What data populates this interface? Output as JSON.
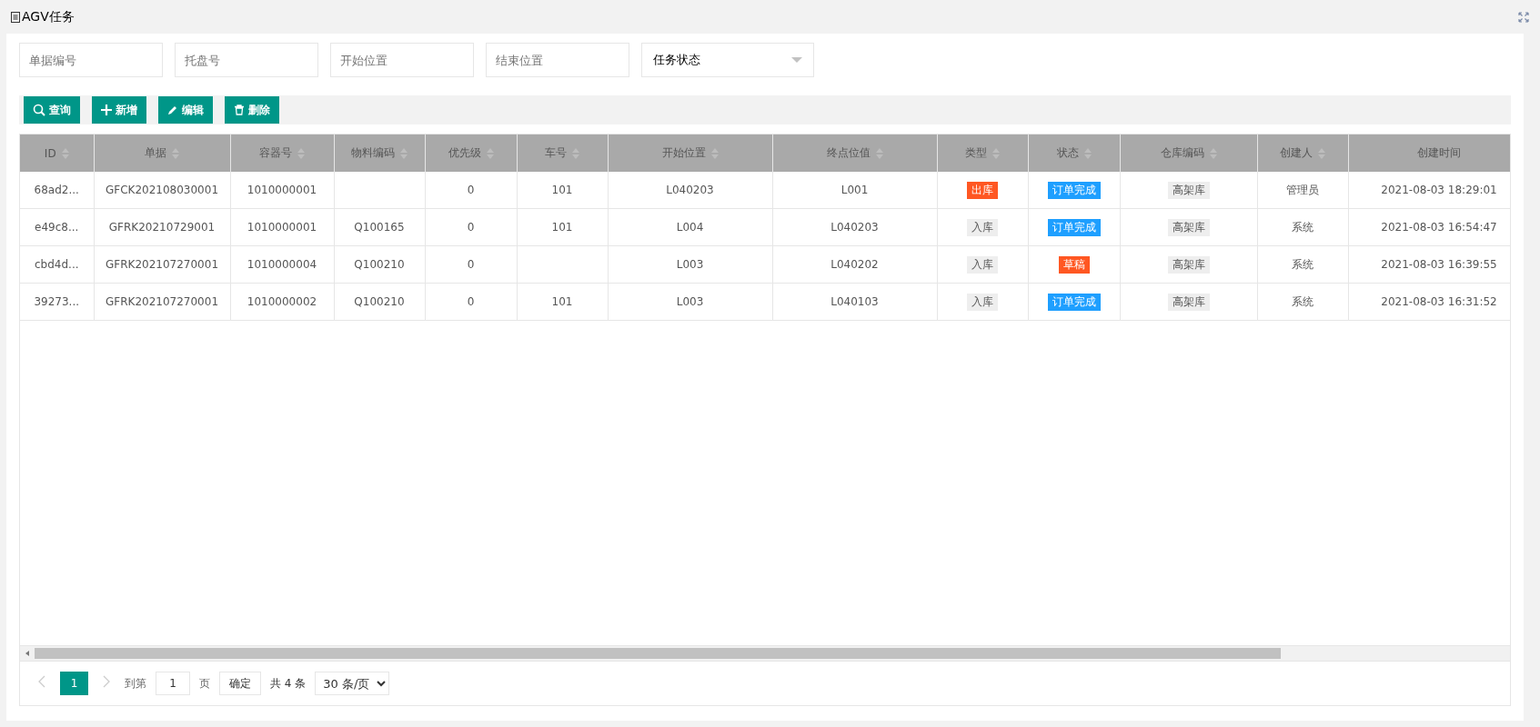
{
  "panel": {
    "title": "AGV任务"
  },
  "filters": [
    {
      "kind": "input",
      "placeholder": "单据编号"
    },
    {
      "kind": "input",
      "placeholder": "托盘号"
    },
    {
      "kind": "input",
      "placeholder": "开始位置"
    },
    {
      "kind": "input",
      "placeholder": "结束位置"
    },
    {
      "kind": "select",
      "value": "任务状态"
    }
  ],
  "toolbar": [
    {
      "kind": "search",
      "label": "查询"
    },
    {
      "kind": "add",
      "label": "新增"
    },
    {
      "kind": "edit",
      "label": "编辑"
    },
    {
      "kind": "delete",
      "label": "删除"
    }
  ],
  "table": {
    "columns": [
      {
        "label": "ID",
        "sortable": true
      },
      {
        "label": "单据",
        "sortable": true
      },
      {
        "label": "容器号",
        "sortable": true
      },
      {
        "label": "物料编码",
        "sortable": true
      },
      {
        "label": "优先级",
        "sortable": true
      },
      {
        "label": "车号",
        "sortable": true
      },
      {
        "label": "开始位置",
        "sortable": true
      },
      {
        "label": "终点位值",
        "sortable": true
      },
      {
        "label": "类型",
        "sortable": true
      },
      {
        "label": "状态",
        "sortable": true
      },
      {
        "label": "仓库编码",
        "sortable": true
      },
      {
        "label": "创建人",
        "sortable": true
      },
      {
        "label": "创建时间",
        "sortable": false
      }
    ],
    "rows": [
      {
        "id": "68ad2...",
        "doc": "GFCK202108030001",
        "container": "1010000001",
        "material": "",
        "priority": "0",
        "vehicle": "101",
        "start": "L040203",
        "end": "L001",
        "type": {
          "text": "出库",
          "color": "#ff5722"
        },
        "status": {
          "text": "订单完成",
          "color": "#1e9fff"
        },
        "warehouse": "高架库",
        "creator": "管理员",
        "created": "2021-08-03 18:29:01"
      },
      {
        "id": "e49c8...",
        "doc": "GFRK20210729001",
        "container": "1010000001",
        "material": "Q100165",
        "priority": "0",
        "vehicle": "101",
        "start": "L004",
        "end": "L040203",
        "type": {
          "text": "入库",
          "color": "#eeeeee"
        },
        "status": {
          "text": "订单完成",
          "color": "#1e9fff"
        },
        "warehouse": "高架库",
        "creator": "系统",
        "created": "2021-08-03 16:54:47"
      },
      {
        "id": "cbd4d...",
        "doc": "GFRK202107270001",
        "container": "1010000004",
        "material": "Q100210",
        "priority": "0",
        "vehicle": "",
        "start": "L003",
        "end": "L040202",
        "type": {
          "text": "入库",
          "color": "#eeeeee"
        },
        "status": {
          "text": "草稿",
          "color": "#ff5722"
        },
        "warehouse": "高架库",
        "creator": "系统",
        "created": "2021-08-03 16:39:55"
      },
      {
        "id": "39273...",
        "doc": "GFRK202107270001",
        "container": "1010000002",
        "material": "Q100210",
        "priority": "0",
        "vehicle": "101",
        "start": "L003",
        "end": "L040103",
        "type": {
          "text": "入库",
          "color": "#eeeeee"
        },
        "status": {
          "text": "订单完成",
          "color": "#1e9fff"
        },
        "warehouse": "高架库",
        "creator": "系统",
        "created": "2021-08-03 16:31:52"
      }
    ]
  },
  "pagination": {
    "prev": {
      "disabled": true
    },
    "pages": [
      {
        "label": "1",
        "selected": true
      }
    ],
    "next": {
      "disabled": true
    },
    "goto_label": "到第",
    "goto_value": "1",
    "page_unit": "页",
    "confirm": "确定",
    "total": "共 4 条",
    "page_size": "30 条/页"
  }
}
